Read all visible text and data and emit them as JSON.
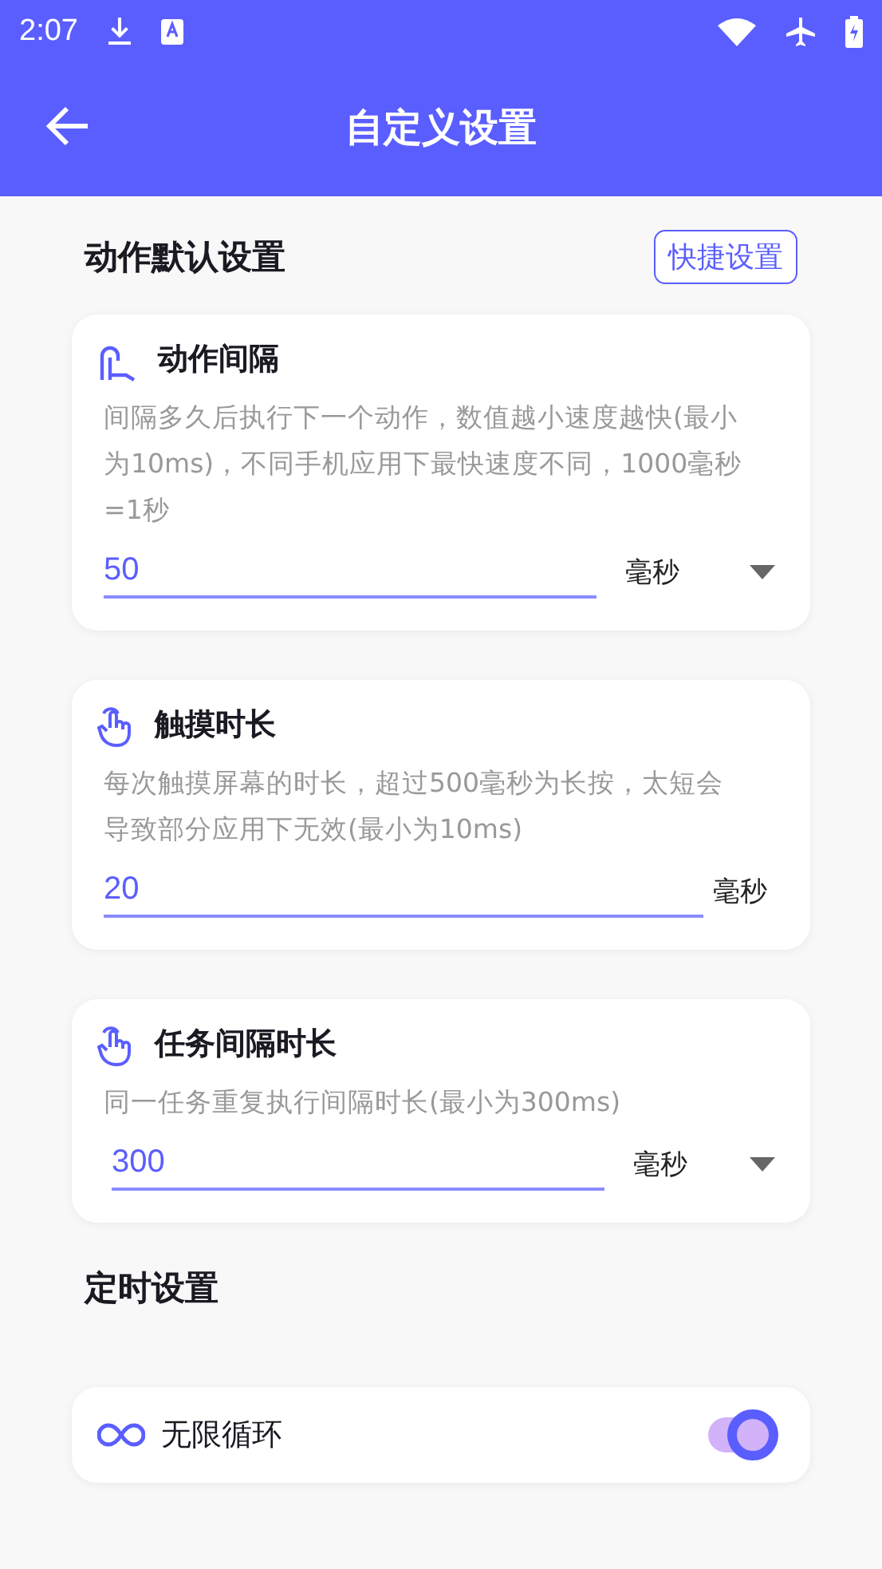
{
  "status_bar": {
    "time": "2:07"
  },
  "app_bar": {
    "title": "自定义设置"
  },
  "section_action": {
    "title": "动作默认设置",
    "button": "快捷设置"
  },
  "cards": [
    {
      "title": "动作间隔",
      "description": "间隔多久后执行下一个动作，数值越小速度越快(最小为10ms)，不同手机应用下最快速度不同，1000毫秒=1秒",
      "value": "50",
      "unit": "毫秒",
      "kind": "dropdown"
    },
    {
      "title": "触摸时长",
      "description": "每次触摸屏幕的时长，超过500毫秒为长按，太短会导致部分应用下无效(最小为10ms)",
      "value": "20",
      "unit": "毫秒",
      "kind": "plain"
    },
    {
      "title": "任务间隔时长",
      "description": "同一任务重复执行间隔时长(最小为300ms)",
      "value": "300",
      "unit": "毫秒",
      "kind": "dropdown"
    }
  ],
  "section_timer": {
    "title": "定时设置"
  },
  "toggle": {
    "label": "无限循环",
    "on": true
  }
}
